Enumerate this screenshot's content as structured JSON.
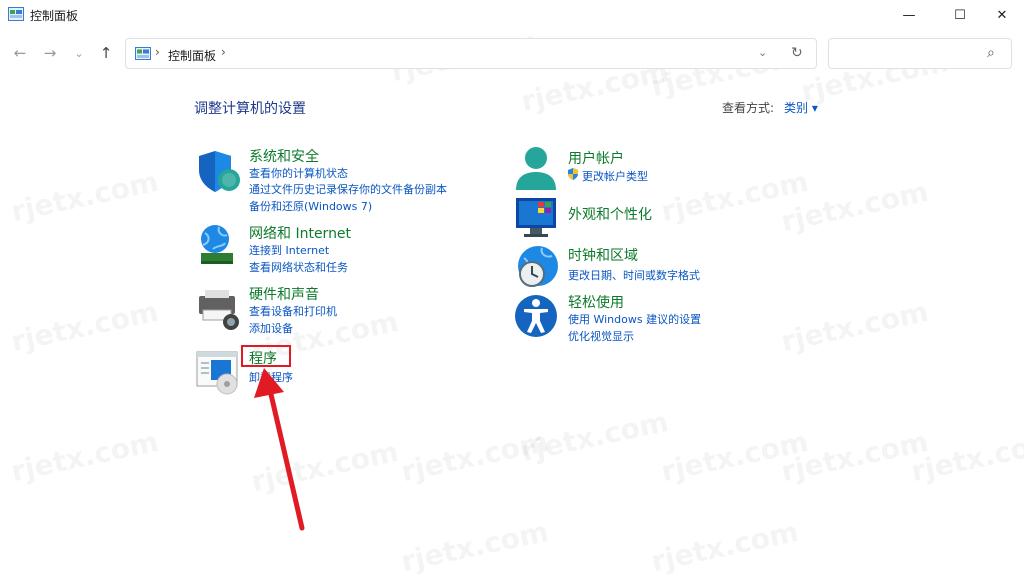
{
  "window": {
    "title": "控制面板",
    "controls": {
      "minimize": "—",
      "maximize": "☐",
      "close": "✕"
    }
  },
  "nav": {
    "back": "←",
    "forward": "→",
    "recent": "⌄",
    "up": "↑",
    "address_text": "控制面板",
    "separator": "›",
    "dropdown": "⌄",
    "refresh": "↻",
    "search_placeholder": "",
    "search_icon": "⌕"
  },
  "header": {
    "heading": "调整计算机的设置",
    "view_by_label": "查看方式:",
    "view_by_value": "类别 ▾"
  },
  "categories": {
    "system_security": {
      "title": "系统和安全",
      "links": [
        "查看你的计算机状态",
        "通过文件历史记录保存你的文件备份副本",
        "备份和还原(Windows 7)"
      ],
      "icon": "shield-icon"
    },
    "network": {
      "title": "网络和 Internet",
      "links": [
        "连接到 Internet",
        "查看网络状态和任务"
      ],
      "icon": "network-globe-icon"
    },
    "hardware_sound": {
      "title": "硬件和声音",
      "links": [
        "查看设备和打印机",
        "添加设备"
      ],
      "icon": "printer-icon"
    },
    "programs": {
      "title": "程序",
      "links": [
        "卸载程序"
      ],
      "icon": "programs-icon"
    },
    "user_accounts": {
      "title": "用户帐户",
      "links": [
        "更改帐户类型"
      ],
      "icon": "user-icon"
    },
    "appearance": {
      "title": "外观和个性化",
      "links": [],
      "icon": "monitor-icon"
    },
    "clock_region": {
      "title": "时钟和区域",
      "links": [
        "更改日期、时间或数字格式"
      ],
      "icon": "clock-globe-icon"
    },
    "ease_access": {
      "title": "轻松使用",
      "links": [
        "使用 Windows 建议的设置",
        "优化视觉显示"
      ],
      "icon": "accessibility-icon"
    }
  },
  "watermark": "rjetx.com",
  "colors": {
    "link": "#0a56c2",
    "category_title": "#0c7a2a",
    "heading": "#1e3a8a",
    "annotation": "#e01b24"
  }
}
